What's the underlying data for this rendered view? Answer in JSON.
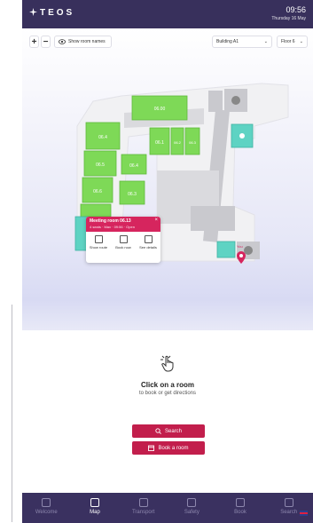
{
  "header": {
    "logo": "TEOS",
    "time": "09:56",
    "date": "Thursday 16 May"
  },
  "toolbar": {
    "zoom_in": "+",
    "zoom_out": "−",
    "show_names": "Show room names",
    "building": "Building A1",
    "floor": "Floor 6"
  },
  "map": {
    "rooms": [
      "06.00",
      "06.4",
      "06.5",
      "06.6",
      "06.4",
      "06.3",
      "06.1",
      "06.2",
      "06.3"
    ],
    "colors": {
      "available": "#7ed957",
      "teal": "#5ed3c3",
      "grey": "#c9c9ce",
      "floor": "#f1f1f3"
    },
    "pin_label": "You"
  },
  "popup": {
    "title": "Meeting room 06.13",
    "subtitle": "4 seats · Max · 09:56 · Open",
    "actions": [
      {
        "label": "Show route"
      },
      {
        "label": "Book now"
      },
      {
        "label": "See details"
      }
    ]
  },
  "prompt": {
    "title": "Click on a room",
    "subtitle": "to book or get directions"
  },
  "buttons": {
    "search": "Search",
    "book": "Book a room"
  },
  "nav": {
    "items": [
      {
        "label": "Welcome",
        "icon": "home-icon"
      },
      {
        "label": "Map",
        "icon": "map-icon",
        "active": true
      },
      {
        "label": "Transport",
        "icon": "transport-icon"
      },
      {
        "label": "Safety",
        "icon": "safety-icon"
      },
      {
        "label": "Book",
        "icon": "book-icon"
      },
      {
        "label": "Search",
        "icon": "search-icon"
      }
    ]
  },
  "colors": {
    "header": "#38305c",
    "accent": "#c21e4c",
    "popup": "#d6255e"
  }
}
